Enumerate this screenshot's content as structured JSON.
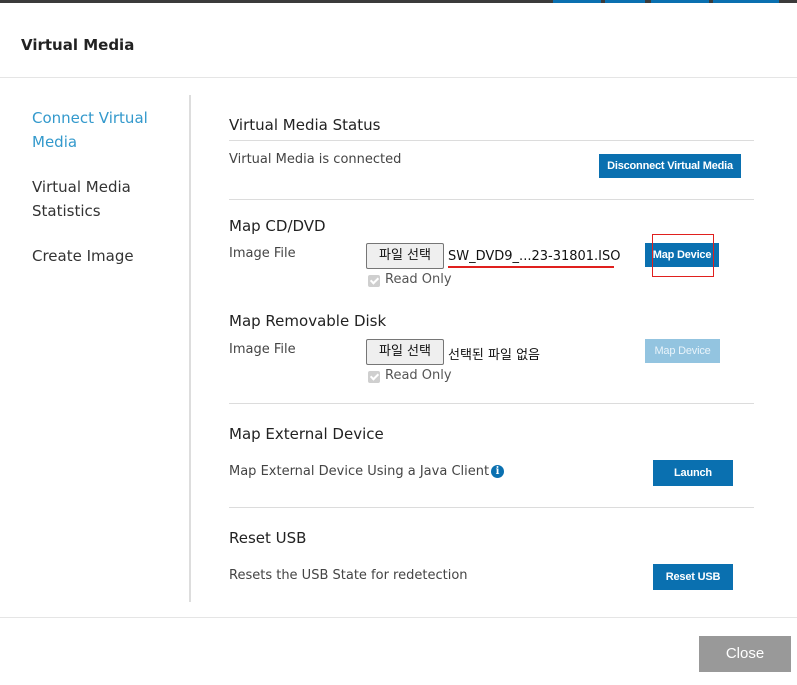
{
  "modal": {
    "title": "Virtual Media"
  },
  "sidebar": {
    "items": [
      {
        "label": "Connect Virtual Media",
        "active": true
      },
      {
        "label": "Virtual Media Statistics",
        "active": false
      },
      {
        "label": "Create Image",
        "active": false
      }
    ]
  },
  "status_section": {
    "title": "Virtual Media Status",
    "status_text": "Virtual Media is connected",
    "disconnect_label": "Disconnect Virtual Media"
  },
  "cd_dvd_section": {
    "title": "Map CD/DVD",
    "image_file_label": "Image File",
    "file_button_label": "파일 선택",
    "file_name": "SW_DVD9_...23-31801.ISO",
    "read_only_label": "Read Only",
    "read_only_checked": true,
    "map_button_label": "Map Device",
    "map_button_enabled": true
  },
  "removable_section": {
    "title": "Map Removable Disk",
    "image_file_label": "Image File",
    "file_button_label": "파일 선택",
    "file_name": "선택된 파일 없음",
    "read_only_label": "Read Only",
    "read_only_checked": true,
    "map_button_label": "Map Device",
    "map_button_enabled": false
  },
  "external_section": {
    "title": "Map External Device",
    "description": "Map External Device Using a Java Client",
    "info_icon": "info-icon",
    "launch_label": "Launch"
  },
  "usb_section": {
    "title": "Reset USB",
    "description": "Resets the USB State for redetection",
    "reset_label": "Reset USB"
  },
  "footer": {
    "close_label": "Close"
  },
  "colors": {
    "accent": "#0a70b0",
    "active_link": "#3399cc",
    "disabled_button": "#93c4e0",
    "annotation_red": "#e0201e",
    "close_button": "#999999"
  }
}
